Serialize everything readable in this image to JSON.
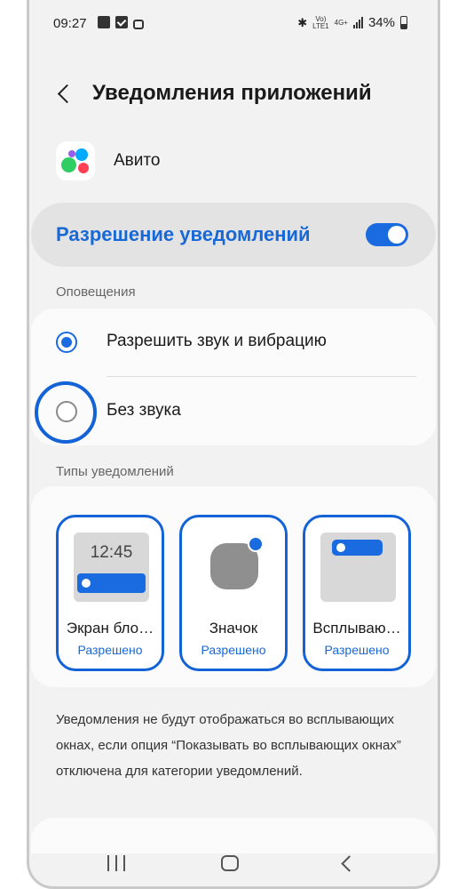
{
  "status_bar": {
    "time": "09:27",
    "network_top": "Vo)\nLTE1",
    "network_4g": "4G+",
    "battery": "34%"
  },
  "header": {
    "title": "Уведомления приложений"
  },
  "app": {
    "name": "Авито",
    "logo_colors": [
      "#00aaff",
      "#2fce62",
      "#ff4053",
      "#965eeb"
    ]
  },
  "permission": {
    "label": "Разрешение уведомлений",
    "enabled": true
  },
  "alerts": {
    "section_label": "Оповещения",
    "options": [
      {
        "label": "Разрешить звук и вибрацию",
        "selected": true
      },
      {
        "label": "Без звука",
        "selected": false
      }
    ]
  },
  "notification_types": {
    "section_label": "Типы уведомлений",
    "tiles": [
      {
        "name": "Экран бло…",
        "status": "Разрешено",
        "preview_time": "12:45"
      },
      {
        "name": "Значок",
        "status": "Разрешено"
      },
      {
        "name": "Всплываю…",
        "status": "Разрешено"
      }
    ]
  },
  "footnote": "Уведомления не будут отображаться во всплывающих окнах, если опция “Показывать во всплывающих окнах” отключена для категории уведомлений.",
  "colors": {
    "accent": "#1a6be0",
    "background": "#f2f2f2",
    "card": "#fbfbfb"
  }
}
